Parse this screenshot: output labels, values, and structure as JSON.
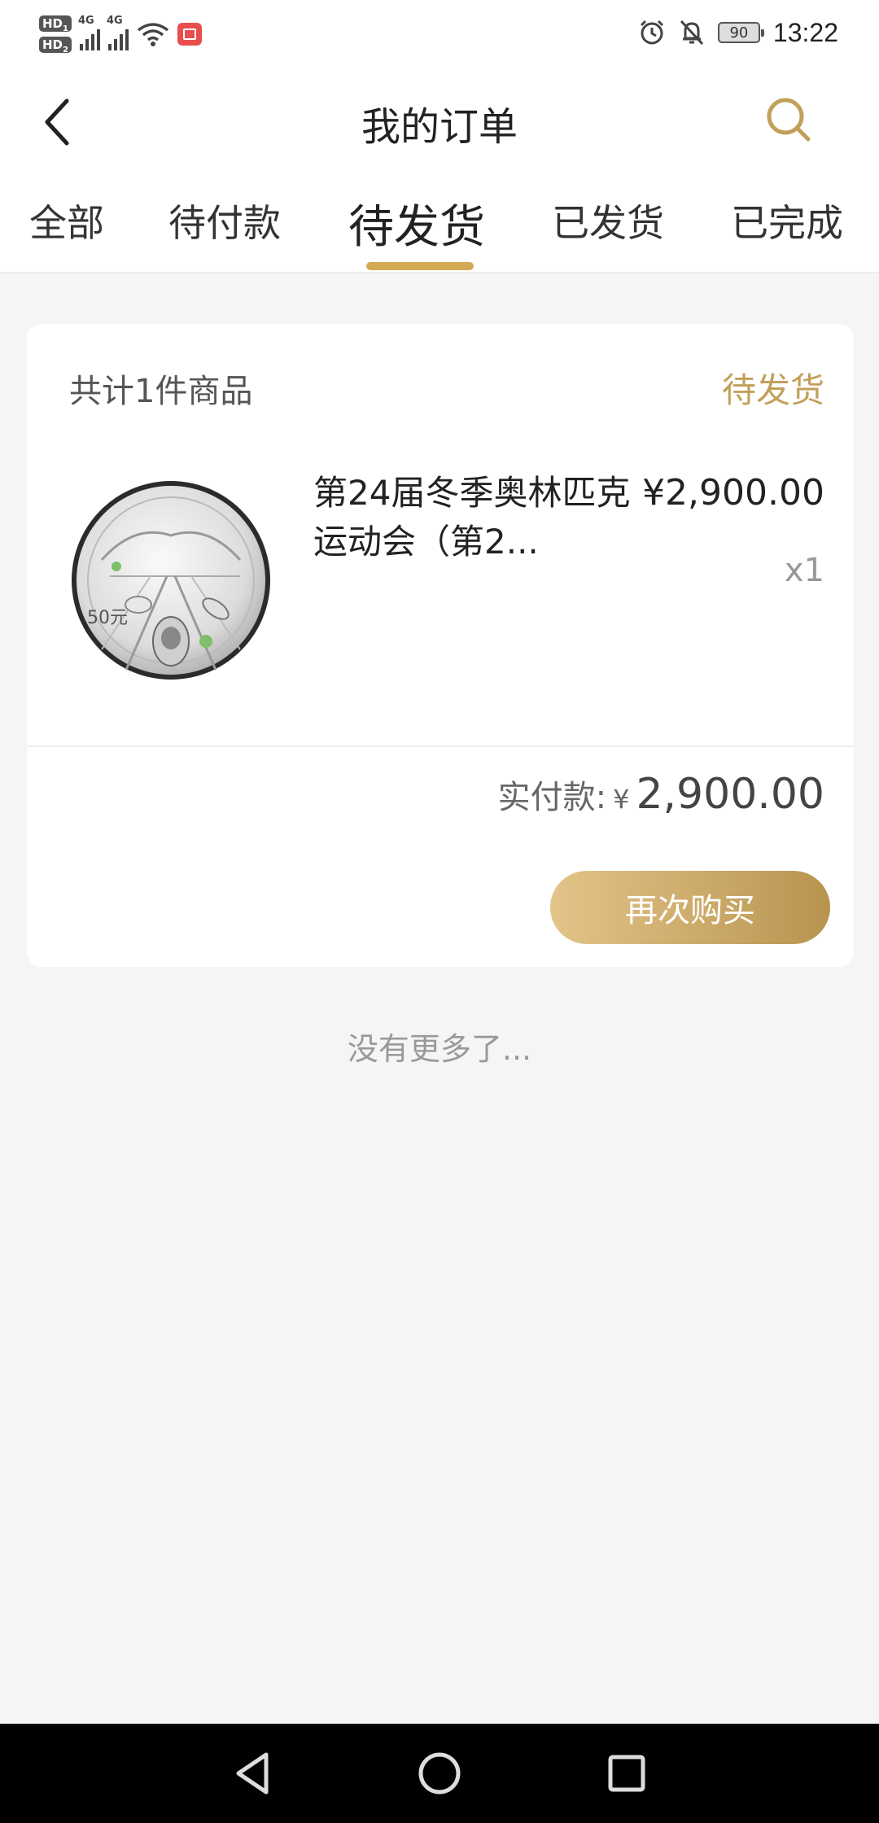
{
  "status_bar": {
    "hd1": "HD",
    "hd1_sub": "1",
    "hd2": "HD",
    "hd2_sub": "2",
    "net1": "4G",
    "net2": "4G",
    "battery": "90",
    "time": "13:22",
    "icons": [
      "signal-icon",
      "wifi-icon",
      "book-app-icon",
      "alarm-icon",
      "bell-off-icon",
      "battery-icon"
    ]
  },
  "header": {
    "title": "我的订单",
    "back_icon": "chevron-left-icon",
    "search_icon": "search-icon",
    "accent_color": "#c2a05a"
  },
  "tabs": [
    {
      "label": "全部",
      "active": false
    },
    {
      "label": "待付款",
      "active": false
    },
    {
      "label": "待发货",
      "active": true
    },
    {
      "label": "已发货",
      "active": false
    },
    {
      "label": "已完成",
      "active": false
    }
  ],
  "order": {
    "count_text": "共计1件商品",
    "status": "待发货",
    "product": {
      "name": "第24届冬季奥林匹克运动会（第2...",
      "price": "¥2,900.00",
      "quantity": "x1",
      "image_text": "50元"
    },
    "paid_label": "实付款:",
    "paid_currency": "¥",
    "paid_amount": "2,900.00",
    "rebuy_label": "再次购买"
  },
  "footer_text": "没有更多了...",
  "nav": {
    "icons": [
      "back-triangle-icon",
      "home-circle-icon",
      "recents-square-icon"
    ]
  }
}
